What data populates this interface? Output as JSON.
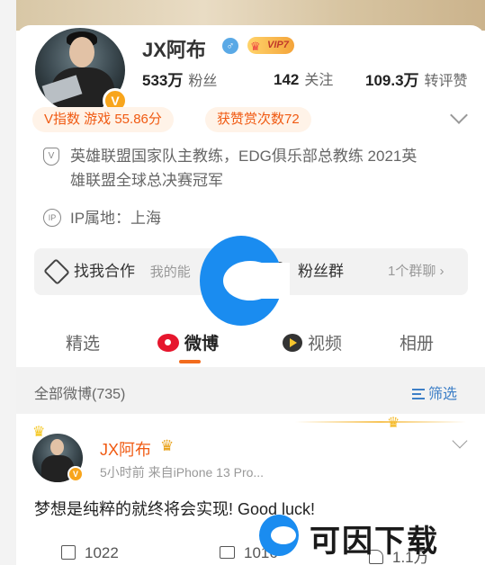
{
  "profile": {
    "name": "JX阿布",
    "vip_label": "VIP7",
    "verified_badge": "V",
    "gender_symbol": "♂",
    "stats": {
      "fans_count": "533万",
      "fans_label": "粉丝",
      "following_count": "142",
      "following_label": "关注",
      "likes_count": "109.3万",
      "likes_label": "转评赞"
    },
    "tags": {
      "v_index": "V指数 游戏 55.86分",
      "reward": "获赞赏次数72"
    },
    "bio": "英雄联盟国家队主教练，EDG俱乐部总教练 2021英雄联盟全球总决赛冠军",
    "bio_line1": "英雄联盟国家队主教练，EDG俱乐部总教练 2021英",
    "bio_line2": "雄联盟全球总决赛冠军",
    "ip_location": "IP属地：上海",
    "icons": {
      "bio_icon": "V",
      "ip_icon": "IP"
    }
  },
  "cooperation": {
    "find_label": "找我合作",
    "find_sub": "我的能",
    "fan_group_label": "粉丝群",
    "fan_group_sub": "1个群聊 ›"
  },
  "tabs": [
    {
      "label": "精选"
    },
    {
      "label": "微博"
    },
    {
      "label": "视频"
    },
    {
      "label": "相册"
    }
  ],
  "feed": {
    "all_label": "全部微博(735)",
    "filter_label": "筛选"
  },
  "post": {
    "author": "JX阿布",
    "meta": "5小时前  来自iPhone 13 Pro...",
    "text": "梦想是纯粹的就终将会实现! Good luck!",
    "share_count": "1022",
    "comment_count": "1016",
    "like_count": "1.1万"
  },
  "watermark": {
    "text": "可因下载"
  },
  "colors": {
    "accent_orange": "#f05a12",
    "link_blue": "#3d7fc7",
    "verified_gold": "#f8a51c",
    "weibo_red": "#e6162d"
  }
}
